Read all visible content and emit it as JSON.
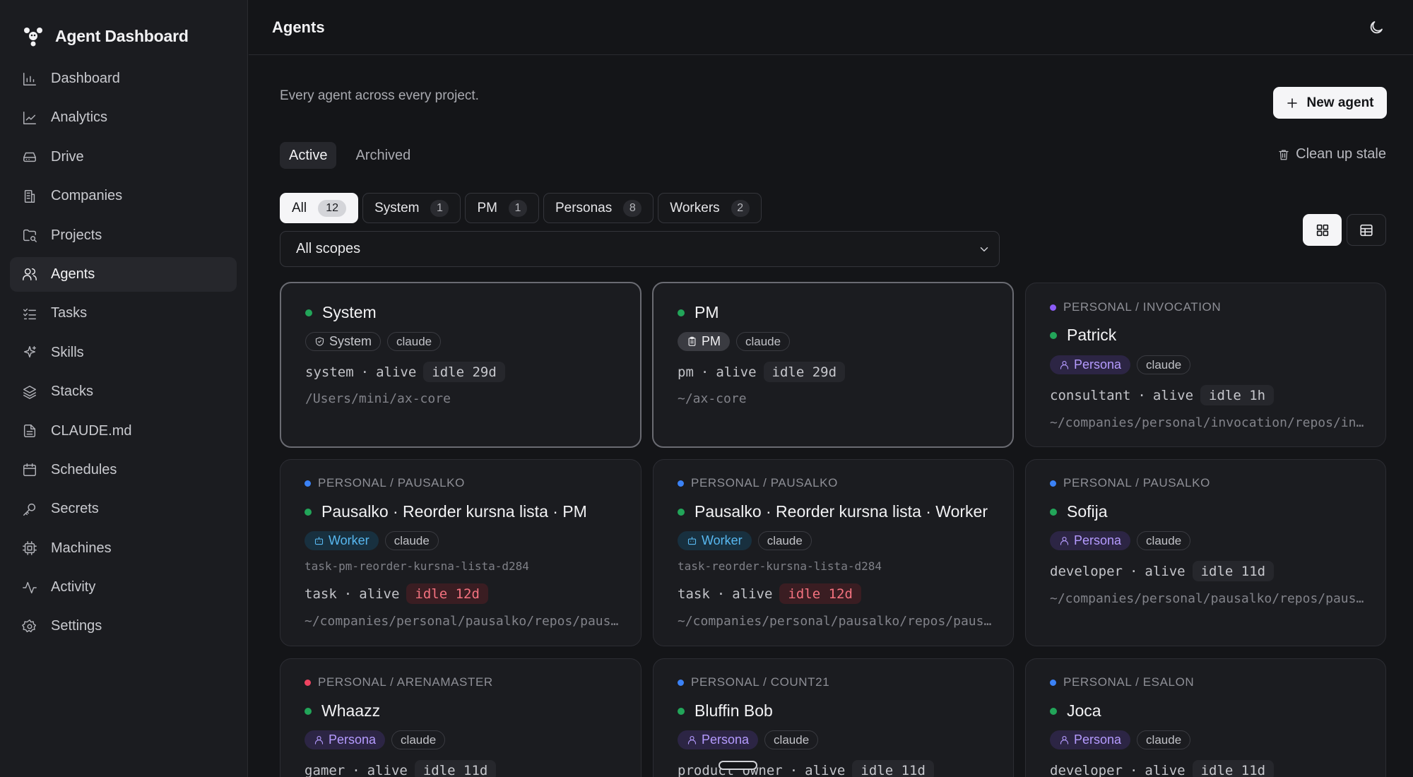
{
  "app": {
    "title": "Agent Dashboard"
  },
  "sidebar": {
    "items": [
      {
        "label": "Dashboard",
        "icon": "bar-chart-icon"
      },
      {
        "label": "Analytics",
        "icon": "line-chart-icon"
      },
      {
        "label": "Drive",
        "icon": "drive-icon"
      },
      {
        "label": "Companies",
        "icon": "building-icon"
      },
      {
        "label": "Projects",
        "icon": "folder-icon"
      },
      {
        "label": "Agents",
        "icon": "users-icon",
        "active": true
      },
      {
        "label": "Tasks",
        "icon": "list-checks-icon"
      },
      {
        "label": "Skills",
        "icon": "sparkles-icon"
      },
      {
        "label": "Stacks",
        "icon": "layers-icon"
      },
      {
        "label": "CLAUDE.md",
        "icon": "file-icon"
      },
      {
        "label": "Schedules",
        "icon": "calendar-icon"
      },
      {
        "label": "Secrets",
        "icon": "key-icon"
      },
      {
        "label": "Machines",
        "icon": "cpu-icon"
      },
      {
        "label": "Activity",
        "icon": "activity-icon"
      },
      {
        "label": "Settings",
        "icon": "gear-icon"
      }
    ]
  },
  "header": {
    "title": "Agents",
    "theme_icon": "moon-icon"
  },
  "main": {
    "subtitle": "Every agent across every project.",
    "new_agent_label": "New agent",
    "tabs": [
      {
        "label": "Active",
        "active": true
      },
      {
        "label": "Archived"
      }
    ],
    "cleanup_label": "Clean up stale",
    "filters": [
      {
        "label": "All",
        "count": "12",
        "active": true
      },
      {
        "label": "System",
        "count": "1"
      },
      {
        "label": "PM",
        "count": "1"
      },
      {
        "label": "Personas",
        "count": "8"
      },
      {
        "label": "Workers",
        "count": "2"
      }
    ],
    "scope_select": {
      "value": "All scopes"
    }
  },
  "colors": {
    "alive": "#22a559",
    "scope_purple": "#8b5cf6",
    "scope_blue": "#3b82f6",
    "scope_red": "#ef4461",
    "stale": "#f4727f"
  },
  "cards": [
    {
      "name": "System",
      "badge": "System",
      "model": "claude",
      "role": "system",
      "state": "alive",
      "idle": "idle 29d",
      "path": "/Users/mini/ax-core"
    },
    {
      "name": "PM",
      "badge": "PM",
      "model": "claude",
      "role": "pm",
      "state": "alive",
      "idle": "idle 29d",
      "path": "~/ax-core"
    },
    {
      "scope": "PERSONAL / INVOCATION",
      "name": "Patrick",
      "badge": "Persona",
      "model": "claude",
      "role": "consultant",
      "state": "alive",
      "idle": "idle 1h",
      "path": "~/companies/personal/invocation/repos/invocation"
    },
    {
      "scope": "PERSONAL / PAUSALKO",
      "name": "Pausalko · Reorder kursna lista · PM",
      "badge": "Worker",
      "model": "claude",
      "task_id": "task-pm-reorder-kursna-lista-d284",
      "role": "task",
      "state": "alive",
      "idle": "idle 12d",
      "path": "~/companies/personal/pausalko/repos/pausalko"
    },
    {
      "scope": "PERSONAL / PAUSALKO",
      "name": "Pausalko · Reorder kursna lista · Worker",
      "badge": "Worker",
      "model": "claude",
      "task_id": "task-reorder-kursna-lista-d284",
      "role": "task",
      "state": "alive",
      "idle": "idle 12d",
      "path": "~/companies/personal/pausalko/repos/pausalko"
    },
    {
      "scope": "PERSONAL / PAUSALKO",
      "name": "Sofija",
      "badge": "Persona",
      "model": "claude",
      "role": "developer",
      "state": "alive",
      "idle": "idle 11d",
      "path": "~/companies/personal/pausalko/repos/pausalko"
    },
    {
      "scope": "PERSONAL / ARENAMASTER",
      "name": "Whaazz",
      "badge": "Persona",
      "model": "claude",
      "role": "gamer",
      "state": "alive",
      "idle": "idle 11d"
    },
    {
      "scope": "PERSONAL / COUNT21",
      "name": "Bluffin Bob",
      "badge": "Persona",
      "model": "claude",
      "role": "product owner",
      "state": "alive",
      "idle": "idle 11d"
    },
    {
      "scope": "PERSONAL / ESALON",
      "name": "Joca",
      "badge": "Persona",
      "model": "claude",
      "role": "developer",
      "state": "alive",
      "idle": "idle 11d"
    }
  ]
}
